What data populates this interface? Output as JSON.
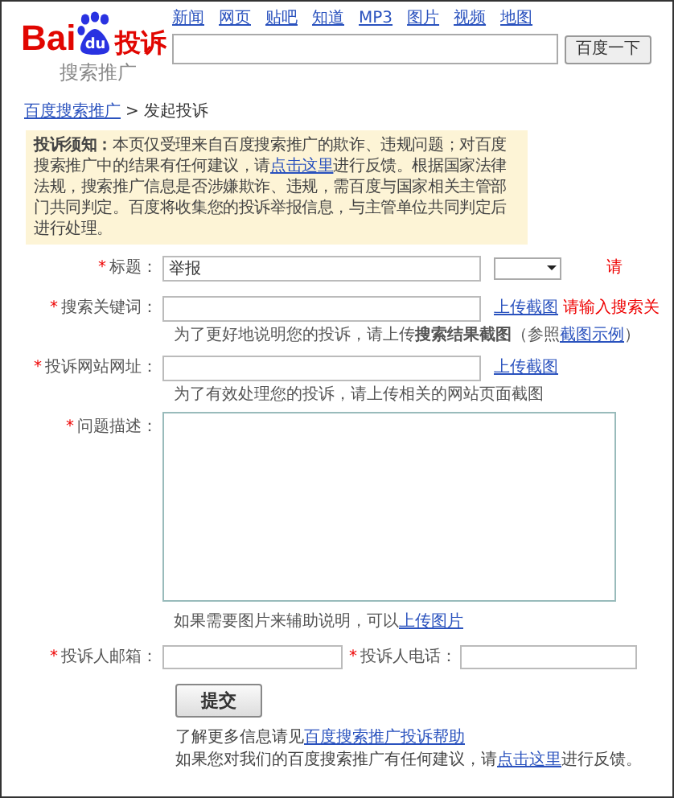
{
  "logo": {
    "bai": "Bai",
    "du": "du",
    "suffix": "投诉",
    "subtitle": "搜索推广"
  },
  "nav": [
    "新闻",
    "网页",
    "贴吧",
    "知道",
    "MP3",
    "图片",
    "视频",
    "地图"
  ],
  "search": {
    "button": "百度一下"
  },
  "breadcrumb": {
    "link": "百度搜索推广",
    "separator": ">",
    "current": "发起投诉"
  },
  "notice": {
    "before": "**投诉须知：**本页仅受理来自百度搜索推广的欺诈、违规问题；对百度搜索推广中的结果有任何建议，请",
    "link": "点击这里",
    "after": "进行反馈。根据国家法律法规，搜索推广信息是否涉嫌欺诈、违规，需百度与国家相关主管部门共同判定。百度将收集您的投诉举报信息，与主管单位共同判定后进行处理。"
  },
  "form": {
    "title_row": {
      "mark": "*",
      "label": "标题：",
      "value": "举报",
      "warning": "请"
    },
    "keyword_row": {
      "mark": "*",
      "label": "搜索关键词：",
      "upload": "上传截图",
      "warning": "请输入搜索关",
      "hint_before": "为了更好地说明您的投诉，请上传",
      "hint_bold": "搜索结果截图",
      "hint_mid": "（参照",
      "hint_link": "截图示例",
      "hint_after": "）"
    },
    "site_row": {
      "mark": "*",
      "label": "投诉网站网址：",
      "upload": "上传截图",
      "hint": "为了有效处理您的投诉，请上传相关的网站页面截图"
    },
    "desc_row": {
      "mark": "*",
      "label": "问题描述：",
      "hint": "如果需要图片来辅助说明，可以",
      "hint_link": "上传图片"
    },
    "email": {
      "mark": "*",
      "label": "投诉人邮箱："
    },
    "phone": {
      "mark": "*",
      "label": "投诉人电话："
    },
    "submit": "提交"
  },
  "footer": [
    {
      "text": "了解更多信息请见",
      "link": "百度搜索推广投诉帮助"
    },
    {
      "text": "如果您对我们的百度搜索推广有任何建议，请",
      "link": "点击这里",
      "after": "进行反馈。"
    }
  ]
}
